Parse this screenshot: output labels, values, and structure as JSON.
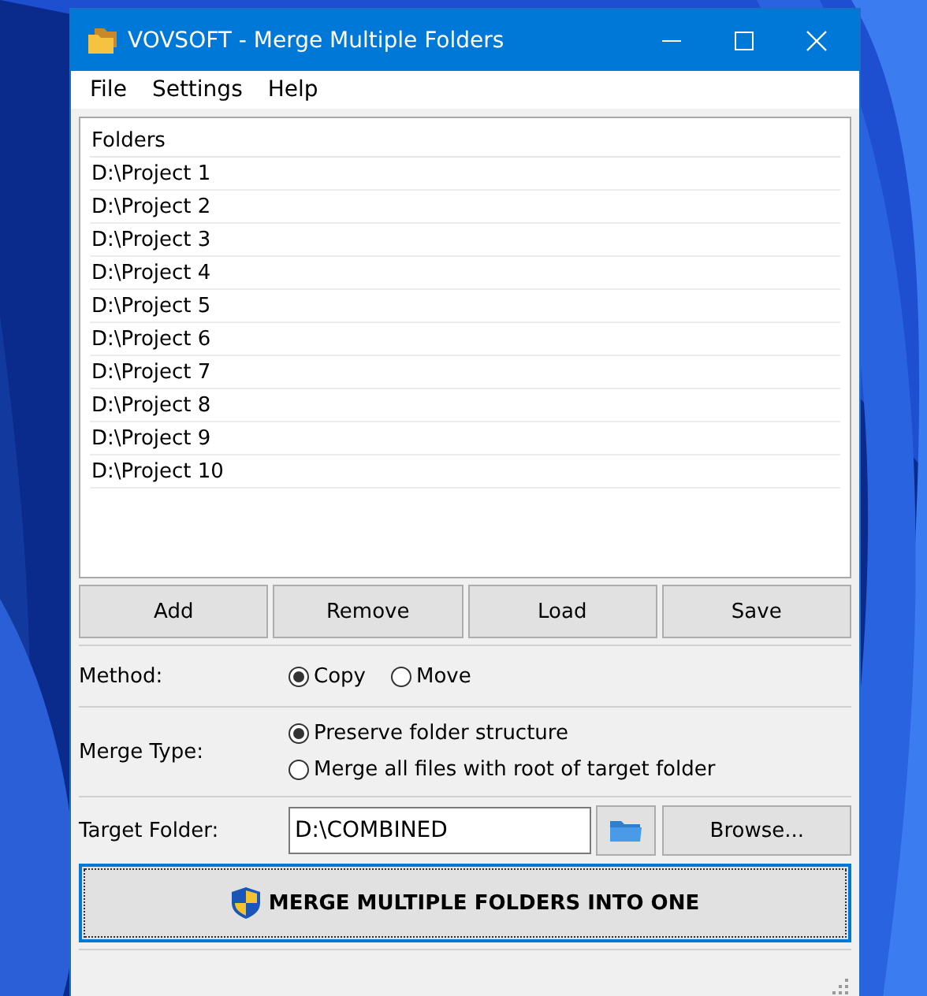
{
  "window": {
    "title": "VOVSOFT - Merge Multiple Folders"
  },
  "menu": [
    "File",
    "Settings",
    "Help"
  ],
  "folders": {
    "header": "Folders",
    "items": [
      {
        "path": "D:\\Project 1"
      },
      {
        "path": "D:\\Project 2"
      },
      {
        "path": "D:\\Project 3"
      },
      {
        "path": "D:\\Project 4"
      },
      {
        "path": "D:\\Project 5"
      },
      {
        "path": "D:\\Project 6"
      },
      {
        "path": "D:\\Project 7"
      },
      {
        "path": "D:\\Project 8"
      },
      {
        "path": "D:\\Project 9"
      },
      {
        "path": "D:\\Project 10"
      }
    ]
  },
  "list_buttons": [
    "Add",
    "Remove",
    "Load",
    "Save"
  ],
  "method": {
    "label": "Method:",
    "options": [
      {
        "label": "Copy",
        "selected": true
      },
      {
        "label": "Move",
        "selected": false
      }
    ]
  },
  "merge_type": {
    "label": "Merge Type:",
    "options": [
      {
        "label": "Preserve folder structure",
        "selected": true
      },
      {
        "label": "Merge all files with root of target folder",
        "selected": false
      }
    ]
  },
  "target_folder": {
    "label": "Target Folder:",
    "value": "D:\\COMBINED",
    "browse": "Browse..."
  },
  "action_button": "MERGE MULTIPLE FOLDERS INTO ONE"
}
